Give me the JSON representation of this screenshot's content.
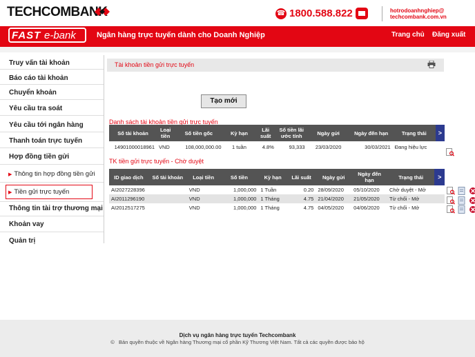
{
  "header": {
    "bank_name": "TECHCOMBANK",
    "hotline": "1800.588.822",
    "email_line1": "hotrodoanhnghiep@",
    "email_line2": "techcombank.com.vn"
  },
  "banner": {
    "logo_fast": "FAST",
    "logo_ebank": "e-bank",
    "title": "Ngân hàng trực tuyến dành cho Doanh Nghiệp",
    "nav_home": "Trang chủ",
    "nav_logout": "Đăng xuất"
  },
  "sidebar": {
    "items": [
      "Truy vấn tài khoản",
      "Báo cáo tài khoản",
      "Chuyển khoản",
      "Yêu cầu tra soát",
      "Yêu cầu tới ngân hàng",
      "Thanh toán trực tuyến",
      "Hợp đồng tiền gửi",
      "Thông tin tài trợ thương mại",
      "Khoản vay",
      "Quản trị"
    ],
    "subitems": [
      "Thông tin hợp đồng tiền gửi",
      "Tiền gửi trực tuyến"
    ]
  },
  "main": {
    "section_title": "Tài khoản tiền gửi trực tuyến",
    "create_button": "Tạo mới",
    "accounts_title": "Danh sách tài khoản tiền gửi trực tuyến",
    "accounts_columns": [
      "Số tài khoản",
      "Loại tiền",
      "Số tiền gốc",
      "Kỳ hạn",
      "Lãi suất",
      "Số tiền lãi ước tính",
      "Ngày gửi",
      "Ngày đến hạn",
      "Trạng thái",
      ">"
    ],
    "accounts_rows": [
      [
        "14901000018961",
        "VND",
        "108,000,000.00",
        "1 tuần",
        "4.8%",
        "93,333",
        "23/03/2020",
        "30/03/2021",
        "Đang hiệu lực"
      ]
    ],
    "pending_title": "TK tiền gửi trực tuyến - Chờ duyệt",
    "pending_columns": [
      "ID giao dịch",
      "Số tài khoản",
      "Loại tiền",
      "Số tiền",
      "Kỳ hạn",
      "Lãi suất",
      "Ngày gửi",
      "Ngày đến hạn",
      "Trạng thái",
      ">"
    ],
    "pending_rows": [
      [
        "AI2027228396",
        "",
        "VND",
        "1,000,000",
        "1 Tuần",
        "0.20",
        "28/09/2020",
        "05/10/2020",
        "Chờ duyệt - Mở"
      ],
      [
        "AI2011296190",
        "",
        "VND",
        "1,000,000",
        "1 Tháng",
        "4.75",
        "21/04/2020",
        "21/05/2020",
        "Từ chối - Mở"
      ],
      [
        "AI2012517275",
        "",
        "VND",
        "1,000,000",
        "1 Tháng",
        "4.75",
        "04/05/2020",
        "04/06/2020",
        "Từ chối - Mở"
      ]
    ]
  },
  "footer": {
    "line1": "Dịch vụ ngân hàng trực tuyến Techcombank",
    "copyright": "©",
    "line2": "Bản quyền thuộc về Ngân hàng Thương mại cổ phần Kỹ Thương Việt Nam. Tất cả các quyền được bảo hộ"
  },
  "colors": {
    "brand_red": "#e30613",
    "header_gray": "#545454",
    "arrow_blue": "#2c3a8f"
  }
}
